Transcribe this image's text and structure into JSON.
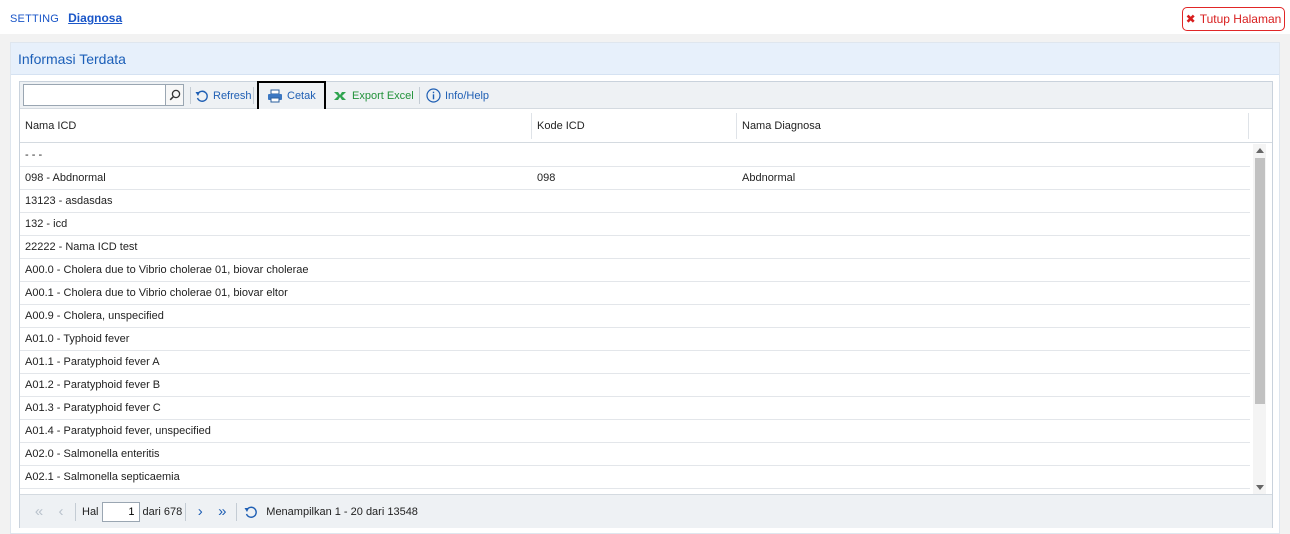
{
  "breadcrumb": {
    "root": "SETTING",
    "current": "Diagnosa"
  },
  "close_button": {
    "label": "Tutup Halaman",
    "icon": "close-icon"
  },
  "panel": {
    "title": "Informasi Terdata"
  },
  "toolbar": {
    "search_value": "",
    "refresh": "Refresh",
    "print": "Cetak",
    "export": "Export Excel",
    "info": "Info/Help"
  },
  "columns": [
    "Nama ICD",
    "Kode ICD",
    "Nama Diagnosa"
  ],
  "rows": [
    [
      "- - -",
      "",
      ""
    ],
    [
      "098 - Abdnormal",
      "098",
      "Abdnormal"
    ],
    [
      "13123 - asdasdas",
      "",
      ""
    ],
    [
      "132 - icd",
      "",
      ""
    ],
    [
      "22222 - Nama ICD test",
      "",
      ""
    ],
    [
      "A00.0 - Cholera due to Vibrio cholerae 01, biovar cholerae",
      "",
      ""
    ],
    [
      "A00.1 - Cholera due to Vibrio cholerae 01, biovar eltor",
      "",
      ""
    ],
    [
      "A00.9 - Cholera, unspecified",
      "",
      ""
    ],
    [
      "A01.0 - Typhoid fever",
      "",
      ""
    ],
    [
      "A01.1 - Paratyphoid fever A",
      "",
      ""
    ],
    [
      "A01.2 - Paratyphoid fever B",
      "",
      ""
    ],
    [
      "A01.3 - Paratyphoid fever C",
      "",
      ""
    ],
    [
      "A01.4 - Paratyphoid fever, unspecified",
      "",
      ""
    ],
    [
      "A02.0 - Salmonella enteritis",
      "",
      ""
    ],
    [
      "A02.1 - Salmonella septicaemia",
      "",
      ""
    ]
  ],
  "pager": {
    "page_label": "Hal",
    "page_value": "1",
    "of_label": "dari 678",
    "summary": "Menampilkan 1 - 20 dari 13548"
  },
  "colors": {
    "accent": "#1f5fb4",
    "close": "#d81e1e",
    "export": "#22923a",
    "header_bg": "#e7f0fb"
  }
}
